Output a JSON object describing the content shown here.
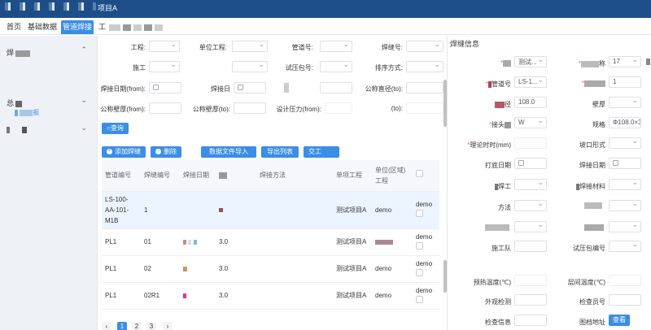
{
  "window": {
    "title": "项目A"
  },
  "nav": {
    "items": [
      "首页",
      "基础数据",
      "管道焊接",
      "工"
    ],
    "active_index": 2
  },
  "sidebar": {
    "group1": "焊",
    "group1_sub": "报",
    "group2": "总",
    "group3": ""
  },
  "filters": {
    "row1": [
      "工程:",
      "单位工程:",
      "管道号:",
      "焊缝号:"
    ],
    "row2": [
      "施工",
      "",
      "试压包号:",
      "排序方式:"
    ],
    "row3": [
      "焊接日期(from):",
      "焊接日",
      "",
      "公称直径(to):"
    ],
    "row4": [
      "公称壁厚(from):",
      "公称壁厚(to):",
      "设计压力(from):",
      "(to):"
    ],
    "search_label": "查询"
  },
  "toolbar": {
    "add": "添加焊缝",
    "delete": "删除",
    "import": "数据文件导入",
    "export": "导出列表",
    "handover": "交工"
  },
  "table": {
    "headers": [
      "管道编号",
      "焊缝编号",
      "焊接日期",
      "",
      "焊接方法",
      "",
      "单项工程",
      "单位(区域)工程",
      ""
    ],
    "rows": [
      [
        "LS-100-AA-101-M1B",
        "1",
        "",
        "",
        "",
        "",
        "测试项目A",
        "demo",
        "demo"
      ],
      [
        "PL1",
        "01",
        "",
        "3.0",
        "",
        "",
        "测试项目A",
        "",
        "demo"
      ],
      [
        "PL1",
        "02",
        "",
        "3.0",
        "",
        "",
        "测试项目A",
        "demo",
        "demo"
      ],
      [
        "PL1",
        "02R1",
        "",
        "3.0",
        "",
        "",
        "测试项目A",
        "demo",
        "demo"
      ]
    ]
  },
  "pagination": {
    "pages": [
      "1",
      "2",
      "3"
    ],
    "prev": "‹",
    "next": "›",
    "current": "1"
  },
  "detail": {
    "title": "焊缝信息",
    "f_test": {
      "value": "测试..."
    },
    "f_spec": {
      "label": "称",
      "value": "17"
    },
    "f_pipe": {
      "label": "管道号",
      "value": "LS-1..."
    },
    "f_count": {
      "value": "1"
    },
    "f_dia": {
      "label": "径",
      "value": "108.0"
    },
    "f_wall": {
      "label": "壁厚"
    },
    "f_joint": {
      "label": "接头",
      "value": "W"
    },
    "f_size": {
      "label": "规格",
      "value": "Φ108.0×3"
    },
    "f_rate": {
      "label": "理论时时(mm)"
    },
    "f_groove": {
      "label": "坡口形式"
    },
    "f_print": {
      "label": "打底日期"
    },
    "f_weld": {
      "label": "焊接日期"
    },
    "f_welder": {
      "label": "焊工"
    },
    "f_material": {
      "label": "焊接材料"
    },
    "f_method": {
      "label": "方法"
    },
    "f_team": {
      "label": "施工队"
    },
    "f_testpack": {
      "label": "试压包编号"
    },
    "f_preheat": {
      "label": "预热温度(℃)"
    },
    "f_interpass": {
      "label": "层间温度(℃)"
    },
    "f_visual": {
      "label": "外观检测"
    },
    "f_inspector": {
      "label": "检查员号"
    },
    "f_check": {
      "label": "检查信息"
    },
    "f_drawing": {
      "label": "图档地址"
    },
    "view_button": "查看"
  }
}
